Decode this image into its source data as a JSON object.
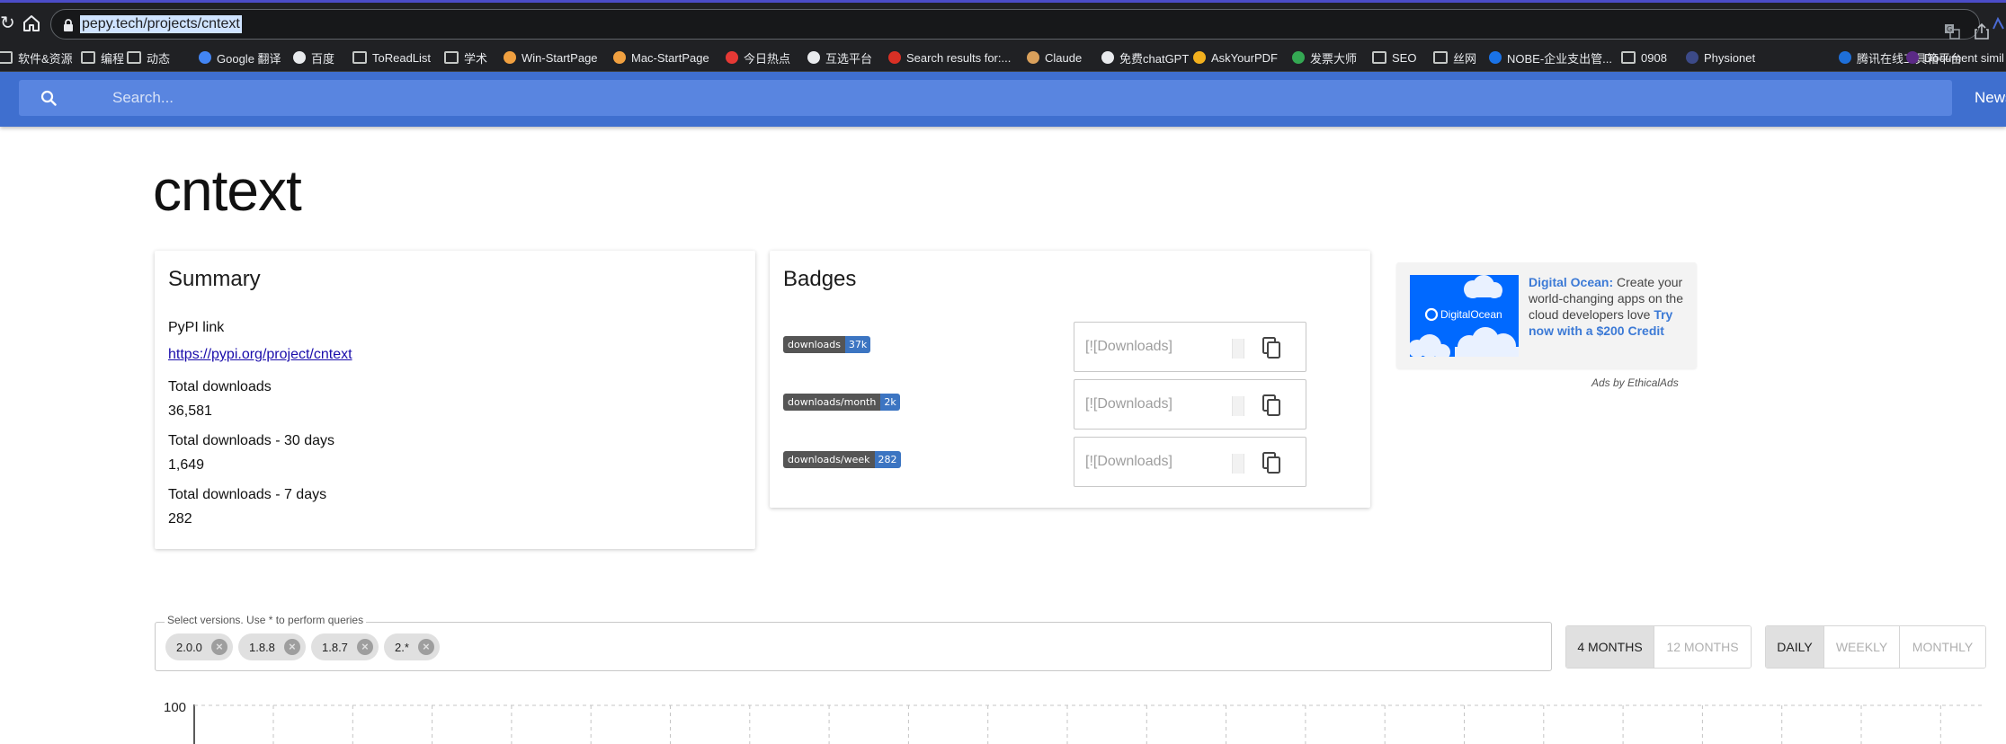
{
  "browser": {
    "url": "pepy.tech/projects/cntext",
    "bookmarks": [
      {
        "label": "软件&资源",
        "icon": "folder-icon"
      },
      {
        "label": "编程",
        "icon": "folder-icon"
      },
      {
        "label": "动态",
        "icon": "folder-icon"
      },
      {
        "label": "Google 翻译",
        "icon": "google-translate-icon"
      },
      {
        "label": "百度",
        "icon": "baidu-icon"
      },
      {
        "label": "ToReadList",
        "icon": "folder-icon"
      },
      {
        "label": "学术",
        "icon": "folder-icon"
      },
      {
        "label": "Win-StartPage",
        "icon": "house-icon"
      },
      {
        "label": "Mac-StartPage",
        "icon": "house-icon"
      },
      {
        "label": "今日热点",
        "icon": "r-logo-icon"
      },
      {
        "label": "互选平台",
        "icon": "hu-xuan-icon"
      },
      {
        "label": "Search results for:...",
        "icon": "site-favicon-icon"
      },
      {
        "label": "Claude",
        "icon": "claude-icon"
      },
      {
        "label": "免费chatGPT",
        "icon": "chatgpt-icon"
      },
      {
        "label": "AskYourPDF",
        "icon": "askyourpdf-icon"
      },
      {
        "label": "发票大师",
        "icon": "invoice-icon"
      },
      {
        "label": "SEO",
        "icon": "folder-icon"
      },
      {
        "label": "丝网",
        "icon": "folder-icon"
      },
      {
        "label": "NOBE-企业支出管...",
        "icon": "nobe-icon"
      },
      {
        "label": "0908",
        "icon": "folder-icon"
      },
      {
        "label": "Physionet",
        "icon": "physionet-icon"
      },
      {
        "label": "腾讯在线工具箱平台",
        "icon": "tencent-icon"
      },
      {
        "label": "Document simil",
        "icon": "w-logo-icon"
      }
    ]
  },
  "header": {
    "search_placeholder": "Search...",
    "news_label": "News"
  },
  "page": {
    "title": "cntext"
  },
  "summary": {
    "title": "Summary",
    "pypi_label": "PyPI link",
    "pypi_url": "https://pypi.org/project/cntext",
    "total_label": "Total downloads",
    "total_value": "36,581",
    "month_label": "Total downloads - 30 days",
    "month_value": "1,649",
    "week_label": "Total downloads - 7 days",
    "week_value": "282"
  },
  "badges": {
    "title": "Badges",
    "items": [
      {
        "left": "downloads",
        "right": "37k",
        "markdown": "[![Downloads]"
      },
      {
        "left": "downloads/month",
        "right": "2k",
        "markdown": "[![Downloads]"
      },
      {
        "left": "downloads/week",
        "right": "282",
        "markdown": "[![Downloads]"
      }
    ]
  },
  "ad": {
    "brand_logo_text": "DigitalOcean",
    "headline": "Digital Ocean:",
    "body": " Create your world-changing apps on the cloud developers love ",
    "cta": "Try now with a $200 Credit",
    "footer": "Ads by EthicalAds"
  },
  "versions": {
    "label": "Select versions. Use * to perform queries",
    "chips": [
      "2.0.0",
      "1.8.8",
      "1.8.7",
      "2.*"
    ]
  },
  "range_buttons": [
    {
      "label": "4 MONTHS",
      "active": true
    },
    {
      "label": "12 MONTHS",
      "active": false
    }
  ],
  "granularity_buttons": [
    {
      "label": "DAILY",
      "active": true
    },
    {
      "label": "WEEKLY",
      "active": false
    },
    {
      "label": "MONTHLY",
      "active": false
    }
  ],
  "chart": {
    "ytick_top": "100"
  },
  "colors": {
    "header_blue": "#3f6fcf",
    "badge_value_blue": "#3c75c2",
    "link": "#1a0dab"
  }
}
